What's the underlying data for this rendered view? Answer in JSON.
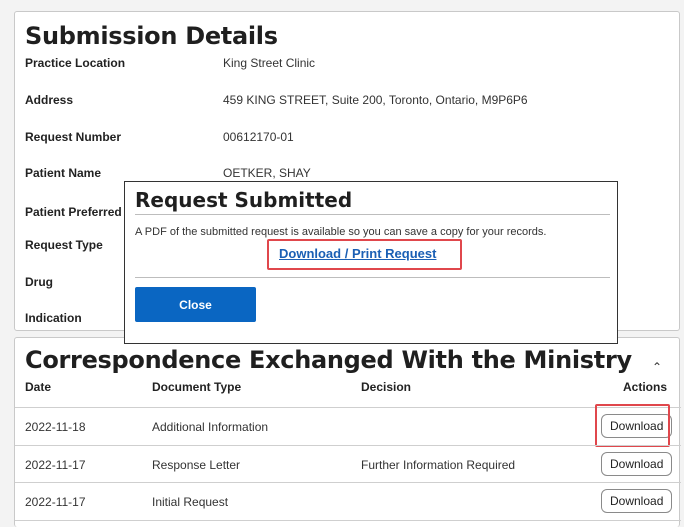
{
  "details": {
    "title": "Submission Details",
    "rows": [
      {
        "label": "Practice Location",
        "value": "King Street Clinic"
      },
      {
        "label": "Address",
        "value": "459 KING STREET, Suite 200, Toronto, Ontario, M9P6P6"
      },
      {
        "label": "Request Number",
        "value": "00612170-01"
      },
      {
        "label": "Patient Name",
        "value": "OETKER, SHAY"
      },
      {
        "label": "Patient Preferred",
        "value": ""
      },
      {
        "label": "Request Type",
        "value": ""
      },
      {
        "label": "Drug",
        "value": ""
      },
      {
        "label": "Indication",
        "value": ""
      }
    ]
  },
  "modal": {
    "title": "Request Submitted",
    "message": "A PDF of the submitted request is available so you can save a copy for your records.",
    "link": "Download / Print Request",
    "close_label": "Close"
  },
  "correspondence": {
    "title": "Correspondence Exchanged With the Ministry",
    "collapse_icon": "chevron-up-icon",
    "headers": {
      "date": "Date",
      "type": "Document Type",
      "decision": "Decision",
      "actions": "Actions"
    },
    "rows": [
      {
        "date": "2022-11-18",
        "type": "Additional Information",
        "decision": "",
        "action": "Download"
      },
      {
        "date": "2022-11-17",
        "type": "Response Letter",
        "decision": "Further Information Required",
        "action": "Download"
      },
      {
        "date": "2022-11-17",
        "type": "Initial Request",
        "decision": "",
        "action": "Download"
      }
    ]
  },
  "colors": {
    "primary": "#0a66c2",
    "link": "#1a5fb4",
    "highlight": "#e0474c"
  }
}
